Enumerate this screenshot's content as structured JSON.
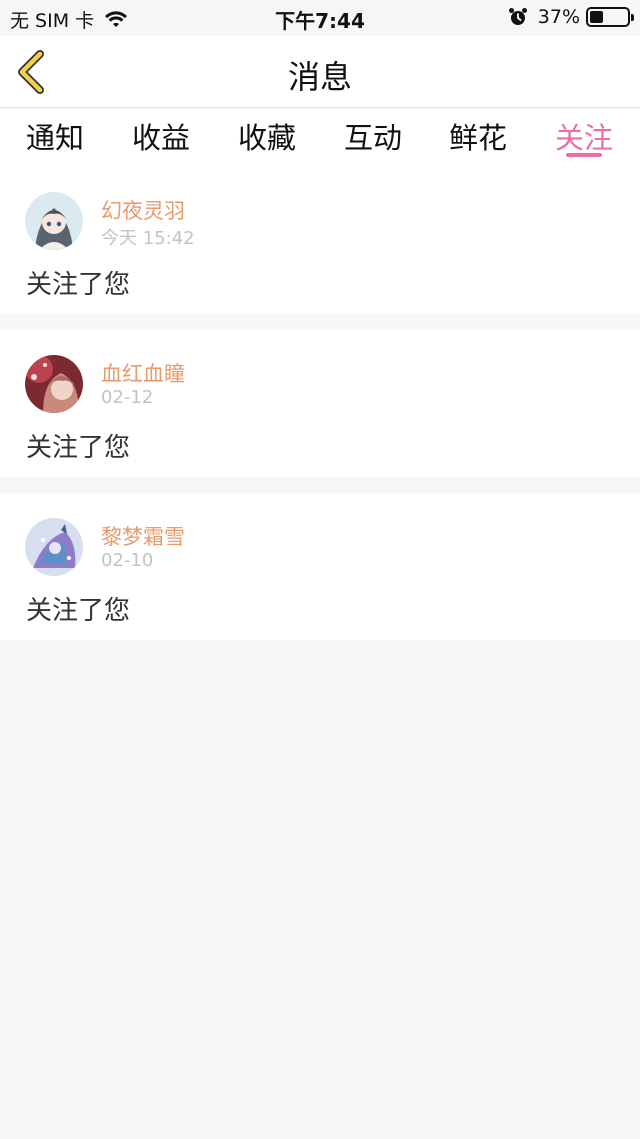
{
  "status_bar": {
    "carrier": "无 SIM 卡",
    "time": "下午7:44",
    "battery_percent": "37%",
    "battery_level": 0.37,
    "icons": [
      "wifi-icon",
      "alarm-icon",
      "battery-icon"
    ]
  },
  "nav": {
    "title": "消息",
    "back_icon": "chevron-left-icon"
  },
  "tabs": [
    {
      "label": "通知"
    },
    {
      "label": "收益"
    },
    {
      "label": "收藏"
    },
    {
      "label": "互动"
    },
    {
      "label": "鲜花"
    },
    {
      "label": "关注",
      "active": true
    }
  ],
  "messages": [
    {
      "name": "幻夜灵羽",
      "time": "今天 15:42",
      "text": "关注了您"
    },
    {
      "name": "血红血瞳",
      "time": "02-12",
      "text": "关注了您"
    },
    {
      "name": "黎梦霜雪",
      "time": "02-10",
      "text": "关注了您"
    }
  ],
  "colors": {
    "accent": "#ec6fa6",
    "username": "#e99a6c",
    "timestamp": "#c3c3c3",
    "back_chevron": "#f2d24a",
    "background": "#f8f6f7"
  }
}
